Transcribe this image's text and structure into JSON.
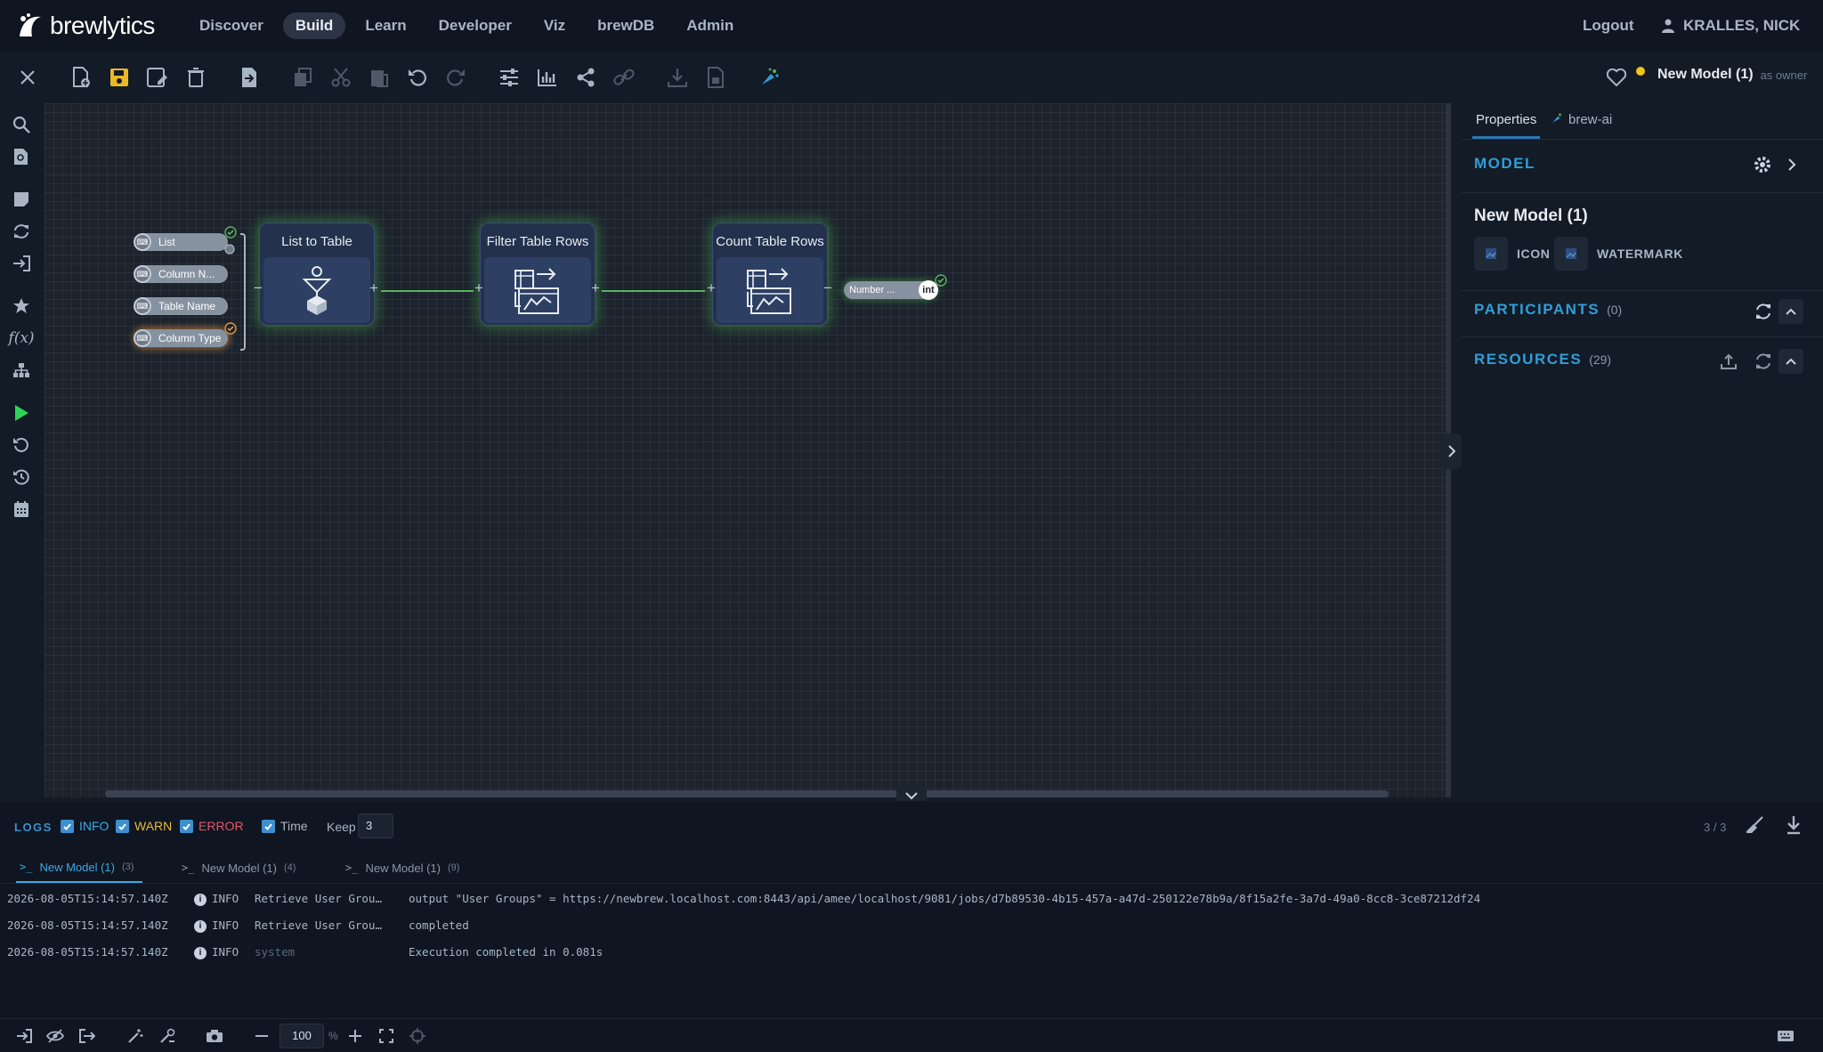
{
  "app": {
    "name": "brewlytics"
  },
  "nav": {
    "items": [
      "Discover",
      "Build",
      "Learn",
      "Developer",
      "Viz",
      "brewDB",
      "Admin"
    ],
    "active": "Build"
  },
  "header": {
    "logout": "Logout",
    "user": "KRALLES, NICK"
  },
  "toolbar": {
    "icons": [
      "close-icon",
      "new-file-icon",
      "save-icon",
      "save-as-icon",
      "delete-icon",
      "import-icon",
      "copy-icon",
      "cut-icon",
      "paste-icon",
      "undo-icon",
      "redo-icon",
      "sliders-icon",
      "chart-icon",
      "share-icon",
      "link-icon",
      "download-icon",
      "export-icon",
      "brew-ai-icon"
    ],
    "model_name": "New Model (1)",
    "model_role": "as owner",
    "status_color": "#f2c318"
  },
  "canvas": {
    "inputs": [
      {
        "label": "List",
        "state": "ok"
      },
      {
        "label": "Column N...",
        "state": "none"
      },
      {
        "label": "Table Name",
        "state": "none"
      },
      {
        "label": "Column Type",
        "state": "ok-highlight"
      }
    ],
    "nodes": [
      {
        "title": "List to Table",
        "icon": "list-to-table-icon"
      },
      {
        "title": "Filter Table Rows",
        "icon": "table-transform-icon"
      },
      {
        "title": "Count Table Rows",
        "icon": "table-transform-icon"
      }
    ],
    "output": {
      "label": "Number ...",
      "type": "int",
      "state": "ok"
    },
    "link_color": "#56b45a"
  },
  "right_panel": {
    "tabs": [
      "Properties",
      "brew-ai"
    ],
    "active_tab": "Properties",
    "model_section": "MODEL",
    "model_title": "New Model (1)",
    "assets": [
      "ICON",
      "WATERMARK"
    ],
    "participants": {
      "label": "PARTICIPANTS",
      "count": "(0)"
    },
    "resources": {
      "label": "RESOURCES",
      "count": "(29)"
    }
  },
  "logs": {
    "label": "LOGS",
    "filters": [
      {
        "label": "INFO",
        "checked": true,
        "color": "#3ea8e4"
      },
      {
        "label": "WARN",
        "checked": true,
        "color": "#e8b83a"
      },
      {
        "label": "ERROR",
        "checked": true,
        "color": "#e0566a"
      },
      {
        "label": "Time",
        "checked": true,
        "color": "#aab5c3"
      }
    ],
    "keep_label": "Keep",
    "keep_value": "3",
    "page": "3 / 3",
    "tabs": [
      {
        "label": "New Model (1)",
        "count": "(3)"
      },
      {
        "label": "New Model (1)",
        "count": "(4)"
      },
      {
        "label": "New Model (1)",
        "count": "(9)"
      }
    ],
    "rows": [
      {
        "time": "2026-08-05T15:14:57.140Z",
        "level": "INFO",
        "source": "Retrieve User Grou…",
        "message": "output \"User Groups\" = https://newbrew.localhost.com:8443/api/amee/localhost/9081/jobs/d7b89530-4b15-457a-a47d-250122e78b9a/8f15a2fe-3a7d-49a0-8cc8-3ce87212df24"
      },
      {
        "time": "2026-08-05T15:14:57.140Z",
        "level": "INFO",
        "source": "Retrieve User Grou…",
        "message": "completed"
      },
      {
        "time": "2026-08-05T15:14:57.140Z",
        "level": "INFO",
        "source": "system",
        "message": "Execution completed in 0.081s"
      }
    ]
  },
  "statusbar": {
    "zoom": "100",
    "zoom_unit": "%"
  }
}
